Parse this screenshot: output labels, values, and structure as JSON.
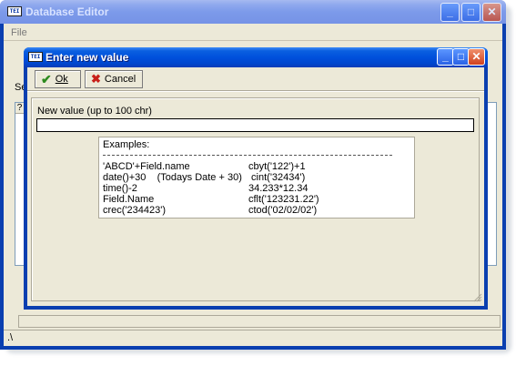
{
  "main_window": {
    "title": "Database Editor",
    "menu_file": "File",
    "partial_label": "Se",
    "grid_header": "?",
    "status_path": ".\\"
  },
  "dialog": {
    "title": "Enter new value",
    "ok_label": "Ok",
    "cancel_label": "Cancel",
    "field_label": "New value (up to 100 chr)",
    "field_value": "",
    "examples_title": "Examples:",
    "examples": [
      {
        "left": "'ABCD'+Field.name",
        "right": "cbyt('122')+1"
      },
      {
        "left": "date()+30    (Todays Date + 30)",
        "right": " cint('32434')"
      },
      {
        "left": "time()-2",
        "right": "34.233*12.34"
      },
      {
        "left": "Field.Name",
        "right": "cflt('123231.22')"
      },
      {
        "left": "crec('234423')",
        "right": "ctod('02/02/02')"
      }
    ]
  },
  "icons": {
    "ok": "checkmark-icon",
    "cancel": "x-icon",
    "app": "app-icon"
  },
  "colors": {
    "titlebar_active": "#0050dc",
    "titlebar_inactive": "#7c9aea",
    "face": "#ece9d8",
    "ok_green": "#2c8a1e",
    "cancel_red": "#c8201a"
  }
}
